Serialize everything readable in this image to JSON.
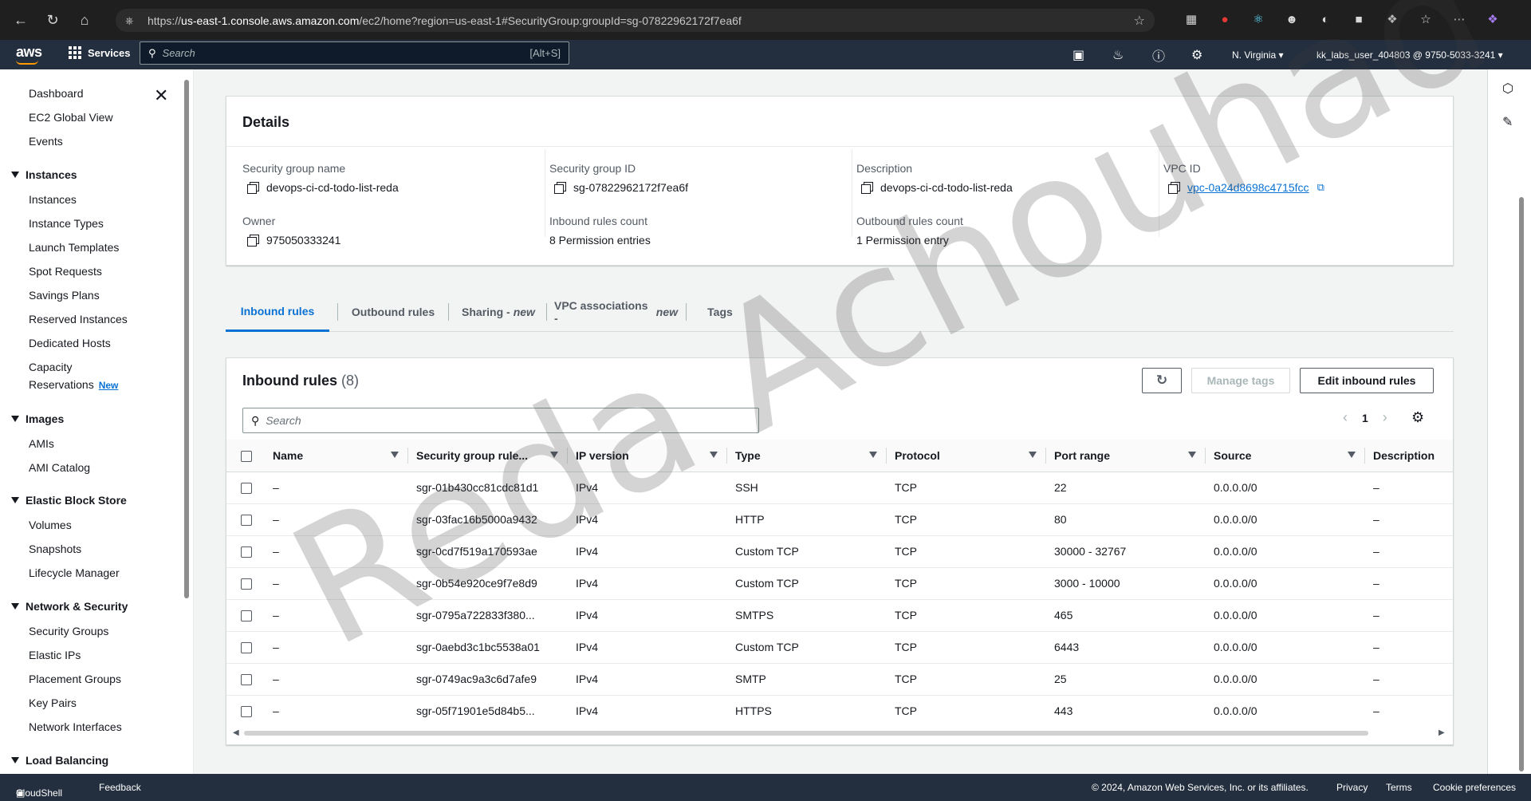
{
  "browser": {
    "url_scheme": "https://",
    "url_host": "us-east-1.console.aws.amazon.com",
    "url_path": "/ec2/home?region=us-east-1#SecurityGroup:groupId=sg-07822962172f7ea6f"
  },
  "aws_nav": {
    "logo": "aws",
    "services_label": "Services",
    "search_placeholder": "Search",
    "search_shortcut": "[Alt+S]",
    "region": "N. Virginia ▾",
    "account": "kk_labs_user_404803 @ 9750-5033-3241 ▾"
  },
  "sidebar": {
    "top_items": [
      "Dashboard",
      "EC2 Global View",
      "Events"
    ],
    "sections": [
      {
        "title": "Instances",
        "items": [
          "Instances",
          "Instance Types",
          "Launch Templates",
          "Spot Requests",
          "Savings Plans",
          "Reserved Instances",
          "Dedicated Hosts",
          "Capacity",
          "Reservations"
        ]
      },
      {
        "title": "Images",
        "items": [
          "AMIs",
          "AMI Catalog"
        ]
      },
      {
        "title": "Elastic Block Store",
        "items": [
          "Volumes",
          "Snapshots",
          "Lifecycle Manager"
        ]
      },
      {
        "title": "Network & Security",
        "items": [
          "Security Groups",
          "Elastic IPs",
          "Placement Groups",
          "Key Pairs",
          "Network Interfaces"
        ]
      },
      {
        "title": "Load Balancing",
        "items": []
      }
    ],
    "new_badge": "New"
  },
  "details": {
    "title": "Details",
    "sg_name_label": "Security group name",
    "sg_name": "devops-ci-cd-todo-list-reda",
    "sg_id_label": "Security group ID",
    "sg_id": "sg-07822962172f7ea6f",
    "description_label": "Description",
    "description": "devops-ci-cd-todo-list-reda",
    "vpc_label": "VPC ID",
    "vpc_id": "vpc-0a24d8698c4715fcc",
    "owner_label": "Owner",
    "owner": "975050333241",
    "inbound_count_label": "Inbound rules count",
    "inbound_count": "8 Permission entries",
    "outbound_count_label": "Outbound rules count",
    "outbound_count": "1 Permission entry"
  },
  "tabs": {
    "inbound": "Inbound rules",
    "outbound": "Outbound rules",
    "sharing": "Sharing -",
    "sharing_new": "new",
    "vpc_assoc": "VPC associations -",
    "vpc_assoc_new": "new",
    "tags": "Tags"
  },
  "rules": {
    "title": "Inbound rules",
    "count": "(8)",
    "manage_tags": "Manage tags",
    "edit_rules": "Edit inbound rules",
    "search_placeholder": "Search",
    "page": "1",
    "columns": [
      "Name",
      "Security group rule...",
      "IP version",
      "Type",
      "Protocol",
      "Port range",
      "Source",
      "Description"
    ],
    "rows": [
      [
        "–",
        "sgr-01b430cc81cdc81d1",
        "IPv4",
        "SSH",
        "TCP",
        "22",
        "0.0.0.0/0",
        "–"
      ],
      [
        "–",
        "sgr-03fac16b5000a9432",
        "IPv4",
        "HTTP",
        "TCP",
        "80",
        "0.0.0.0/0",
        "–"
      ],
      [
        "–",
        "sgr-0cd7f519a170593ae",
        "IPv4",
        "Custom TCP",
        "TCP",
        "30000 - 32767",
        "0.0.0.0/0",
        "–"
      ],
      [
        "–",
        "sgr-0b54e920ce9f7e8d9",
        "IPv4",
        "Custom TCP",
        "TCP",
        "3000 - 10000",
        "0.0.0.0/0",
        "–"
      ],
      [
        "–",
        "sgr-0795a722833f380...",
        "IPv4",
        "SMTPS",
        "TCP",
        "465",
        "0.0.0.0/0",
        "–"
      ],
      [
        "–",
        "sgr-0aebd3c1bc5538a01",
        "IPv4",
        "Custom TCP",
        "TCP",
        "6443",
        "0.0.0.0/0",
        "–"
      ],
      [
        "–",
        "sgr-0749ac9a3c6d7afe9",
        "IPv4",
        "SMTP",
        "TCP",
        "25",
        "0.0.0.0/0",
        "–"
      ],
      [
        "–",
        "sgr-05f71901e5d84b5...",
        "IPv4",
        "HTTPS",
        "TCP",
        "443",
        "0.0.0.0/0",
        "–"
      ]
    ]
  },
  "footer": {
    "cloudshell": "CloudShell",
    "feedback": "Feedback",
    "copyright": "© 2024, Amazon Web Services, Inc. or its affiliates.",
    "privacy": "Privacy",
    "terms": "Terms",
    "cookies": "Cookie preferences"
  },
  "watermark": "Reda Achouhad"
}
